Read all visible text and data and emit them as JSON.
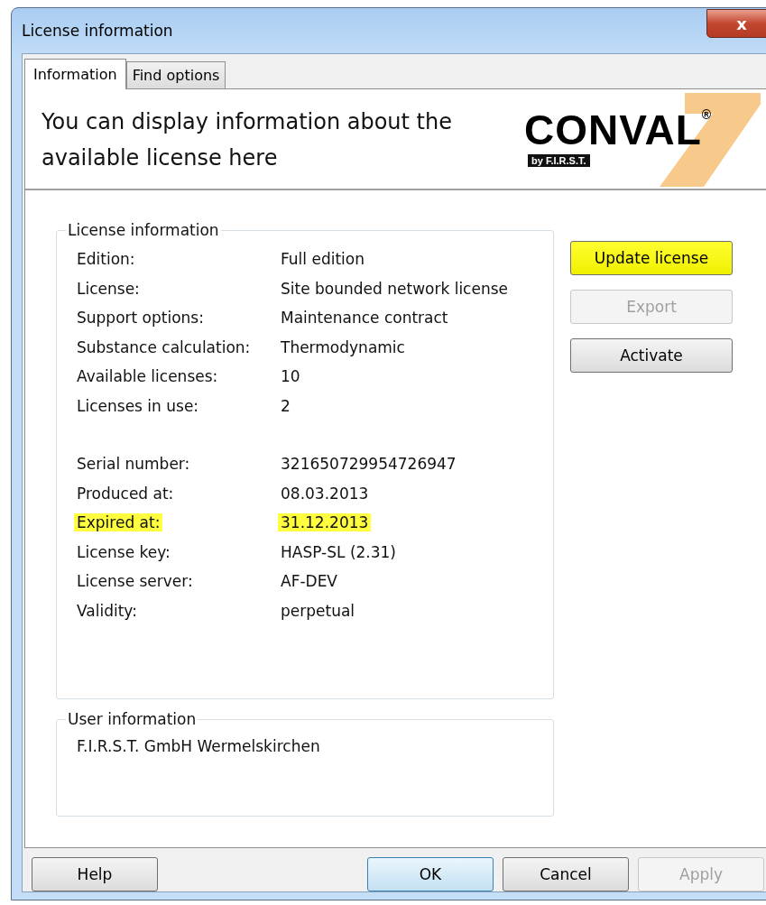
{
  "window": {
    "title": "License information",
    "close": "x"
  },
  "tabs": [
    {
      "label": "Information",
      "selected": true
    },
    {
      "label": "Find options",
      "selected": false
    }
  ],
  "header": {
    "text": "You can display information about the available license here",
    "logo": "CONVAL$^{®}$",
    "logo_sub": "by F.I.R.S.T."
  },
  "license_group": {
    "title": "License information",
    "sections": [
      [
        {
          "label": "Edition:",
          "value": "Full edition",
          "highlighted": false
        },
        {
          "label": "License:",
          "value": "Site bounded network license",
          "highlighted": false
        },
        {
          "label": "Support options:",
          "value": "Maintenance contract",
          "highlighted": false
        },
        {
          "label": "Substance calculation:",
          "value": "Thermodynamic",
          "highlighted": false
        },
        {
          "label": "Available licenses:",
          "value": "10",
          "highlighted": false
        },
        {
          "label": "Licenses in use:",
          "value": "2",
          "highlighted": false
        }
      ],
      [
        {
          "label": "Serial number:",
          "value": "321650729954726947",
          "highlighted": false
        },
        {
          "label": "Produced at:",
          "value": "08.03.2013",
          "highlighted": false
        },
        {
          "label": "Expired at:",
          "value": "31.12.2013",
          "highlighted": true
        },
        {
          "label": "License key:",
          "value": "HASP-SL (2.31)",
          "highlighted": false
        },
        {
          "label": "License server:",
          "value": "AF-DEV",
          "highlighted": false
        },
        {
          "label": "Validity:",
          "value": "perpetual",
          "highlighted": false
        }
      ]
    ]
  },
  "side_buttons": [
    {
      "label": "Update license",
      "disabled": false,
      "highlighted": true
    },
    {
      "label": "Export",
      "disabled": true,
      "highlighted": false
    },
    {
      "label": "Activate",
      "disabled": false,
      "highlighted": false
    }
  ],
  "user_group": {
    "title": "User information",
    "text": "F.I.R.S.T. GmbH Wermelskirchen"
  },
  "footer_buttons": [
    {
      "label": "Help",
      "disabled": false,
      "default": false
    },
    {
      "label": "OK",
      "disabled": false,
      "default": true
    },
    {
      "label": "Cancel",
      "disabled": false,
      "default": false
    },
    {
      "label": "Apply",
      "disabled": true,
      "default": false
    }
  ]
}
